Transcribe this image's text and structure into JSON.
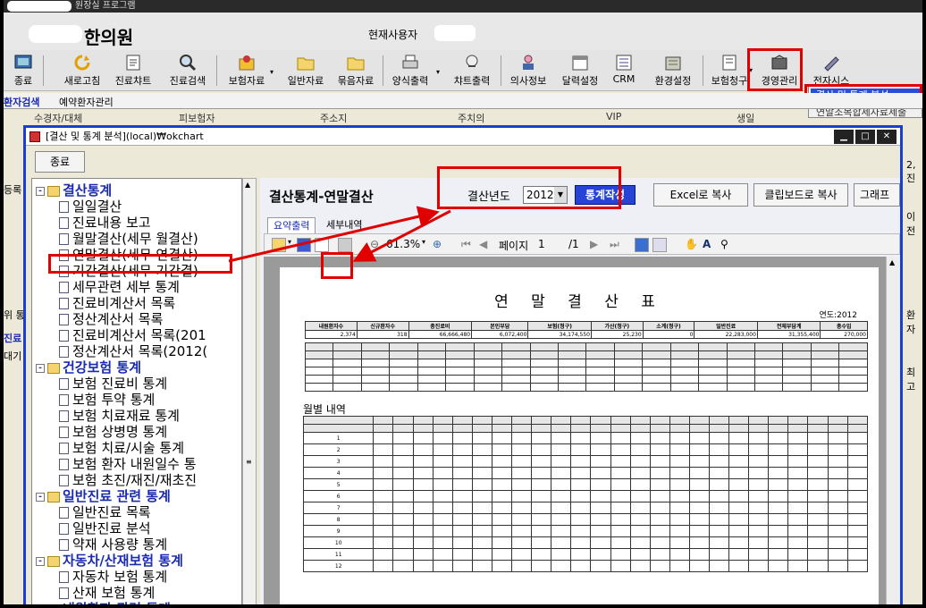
{
  "app": {
    "title": "원장실 프로그램",
    "clinic_name": "한의원",
    "current_user_label": "현재사용자"
  },
  "toolbar": [
    {
      "label": "종료",
      "icon": "exit-icon"
    },
    {
      "label": "새로고침",
      "icon": "refresh-icon"
    },
    {
      "label": "진료챠트",
      "icon": "chart-icon"
    },
    {
      "label": "진료검색",
      "icon": "search-icon"
    },
    {
      "label": "보험자료",
      "icon": "insurance-icon"
    },
    {
      "label": "일반자료",
      "icon": "folder-icon"
    },
    {
      "label": "묶음자료",
      "icon": "folder-icon"
    },
    {
      "label": "양식출력",
      "icon": "printer-icon"
    },
    {
      "label": "챠트출력",
      "icon": "chart-print-icon"
    },
    {
      "label": "의사정보",
      "icon": "doctor-icon"
    },
    {
      "label": "달력설정",
      "icon": "calendar-icon"
    },
    {
      "label": "CRM",
      "icon": "crm-icon"
    },
    {
      "label": "환경설정",
      "icon": "settings-icon"
    },
    {
      "label": "보험청구",
      "icon": "claim-icon"
    },
    {
      "label": "경영관리",
      "icon": "management-icon"
    },
    {
      "label": "전자시스",
      "icon": "system-icon"
    }
  ],
  "popup_menu": {
    "selected": "결산 및 통계 분석",
    "second": "연말조복합세자료제출"
  },
  "bg_tabs": {
    "tab1": "환자검색",
    "tab2": "예약환자관리"
  },
  "bg_columns": [
    "수경자/대체",
    "피보험자",
    "주소지",
    "주치의",
    "VIP",
    "생일"
  ],
  "bg_side": {
    "a": "등록",
    "b": "위 통",
    "c": "진료",
    "d": "대기",
    "e": "환자",
    "f": "이전",
    "g": "2, 진",
    "h": "최고"
  },
  "child_window": {
    "title": "[결산 및 통계 분석](local)₩okchart",
    "close_label": "종료"
  },
  "tree": [
    {
      "text": "결산통계",
      "type": "cat",
      "box": "-"
    },
    {
      "text": "일일결산",
      "type": "leaf"
    },
    {
      "text": "진료내용 보고",
      "type": "leaf"
    },
    {
      "text": "월말결산(세무 월결산)",
      "type": "leaf"
    },
    {
      "text": "연말결산(세무 연결산)",
      "type": "leaf"
    },
    {
      "text": "기간결산(세무 기간결)",
      "type": "leaf"
    },
    {
      "text": "세무관련 세부 통계",
      "type": "leaf"
    },
    {
      "text": "진료비계산서 목록",
      "type": "leaf"
    },
    {
      "text": "정산계산서 목록",
      "type": "leaf"
    },
    {
      "text": "진료비계산서 목록(201",
      "type": "leaf"
    },
    {
      "text": "정산계산서 목록(2012(",
      "type": "leaf"
    },
    {
      "text": "건강보험 통계",
      "type": "cat",
      "box": "-"
    },
    {
      "text": "보험 진료비 통계",
      "type": "leaf"
    },
    {
      "text": "보험 투약 통계",
      "type": "leaf"
    },
    {
      "text": "보험 치료재료 통계",
      "type": "leaf"
    },
    {
      "text": "보험 상병명 통계",
      "type": "leaf"
    },
    {
      "text": "보험 치료/시술 통계",
      "type": "leaf"
    },
    {
      "text": "보험 환자 내원일수 통",
      "type": "leaf"
    },
    {
      "text": "보험 초진/재진/재초진",
      "type": "leaf"
    },
    {
      "text": "일반진료 관련 통계",
      "type": "cat",
      "box": "-"
    },
    {
      "text": "일반진료 목록",
      "type": "leaf"
    },
    {
      "text": "일반진료 분석",
      "type": "leaf"
    },
    {
      "text": "약재 사용량 통계",
      "type": "leaf"
    },
    {
      "text": "자동차/산재보험 통계",
      "type": "cat",
      "box": "-"
    },
    {
      "text": "자동차 보험 통계",
      "type": "leaf"
    },
    {
      "text": "산재 보험 통계",
      "type": "leaf"
    },
    {
      "text": "내원환자 관련 통계",
      "type": "cat",
      "box": "-"
    }
  ],
  "panel": {
    "title": "결산통계-연말결산",
    "year_label": "결산년도",
    "year_value": "2012",
    "generate_label": "통계작성",
    "excel_label": "Excel로 복사",
    "clipboard_label": "클립보드로 복사",
    "graph_label": "그래프로 ..",
    "tab_summary": "요약출력",
    "tab_detail": "세부내역",
    "zoom": "61.3%",
    "page_label": "페이지",
    "page_current": "1",
    "page_total": "/1"
  },
  "report": {
    "title": "연 말 결 산 표",
    "year_text": "연도:2012",
    "monthly_title": "월별 내역",
    "summary_headers": [
      "내원환자수",
      "신규환자수",
      "총진료비",
      "본인부담",
      "보험(청구)",
      "가산(청구)",
      "소계(청구)",
      "일반진료",
      "전체부담계",
      "총수입"
    ],
    "summary_values": [
      "2,374",
      "318",
      "66,666,480",
      "6,072,400",
      "34,174,550",
      "25,230",
      "0",
      "22,283,000",
      "31,355,400",
      "270,000"
    ],
    "months": [
      "1",
      "2",
      "3",
      "4",
      "5",
      "6",
      "7",
      "8",
      "9",
      "10",
      "11",
      "12"
    ]
  }
}
